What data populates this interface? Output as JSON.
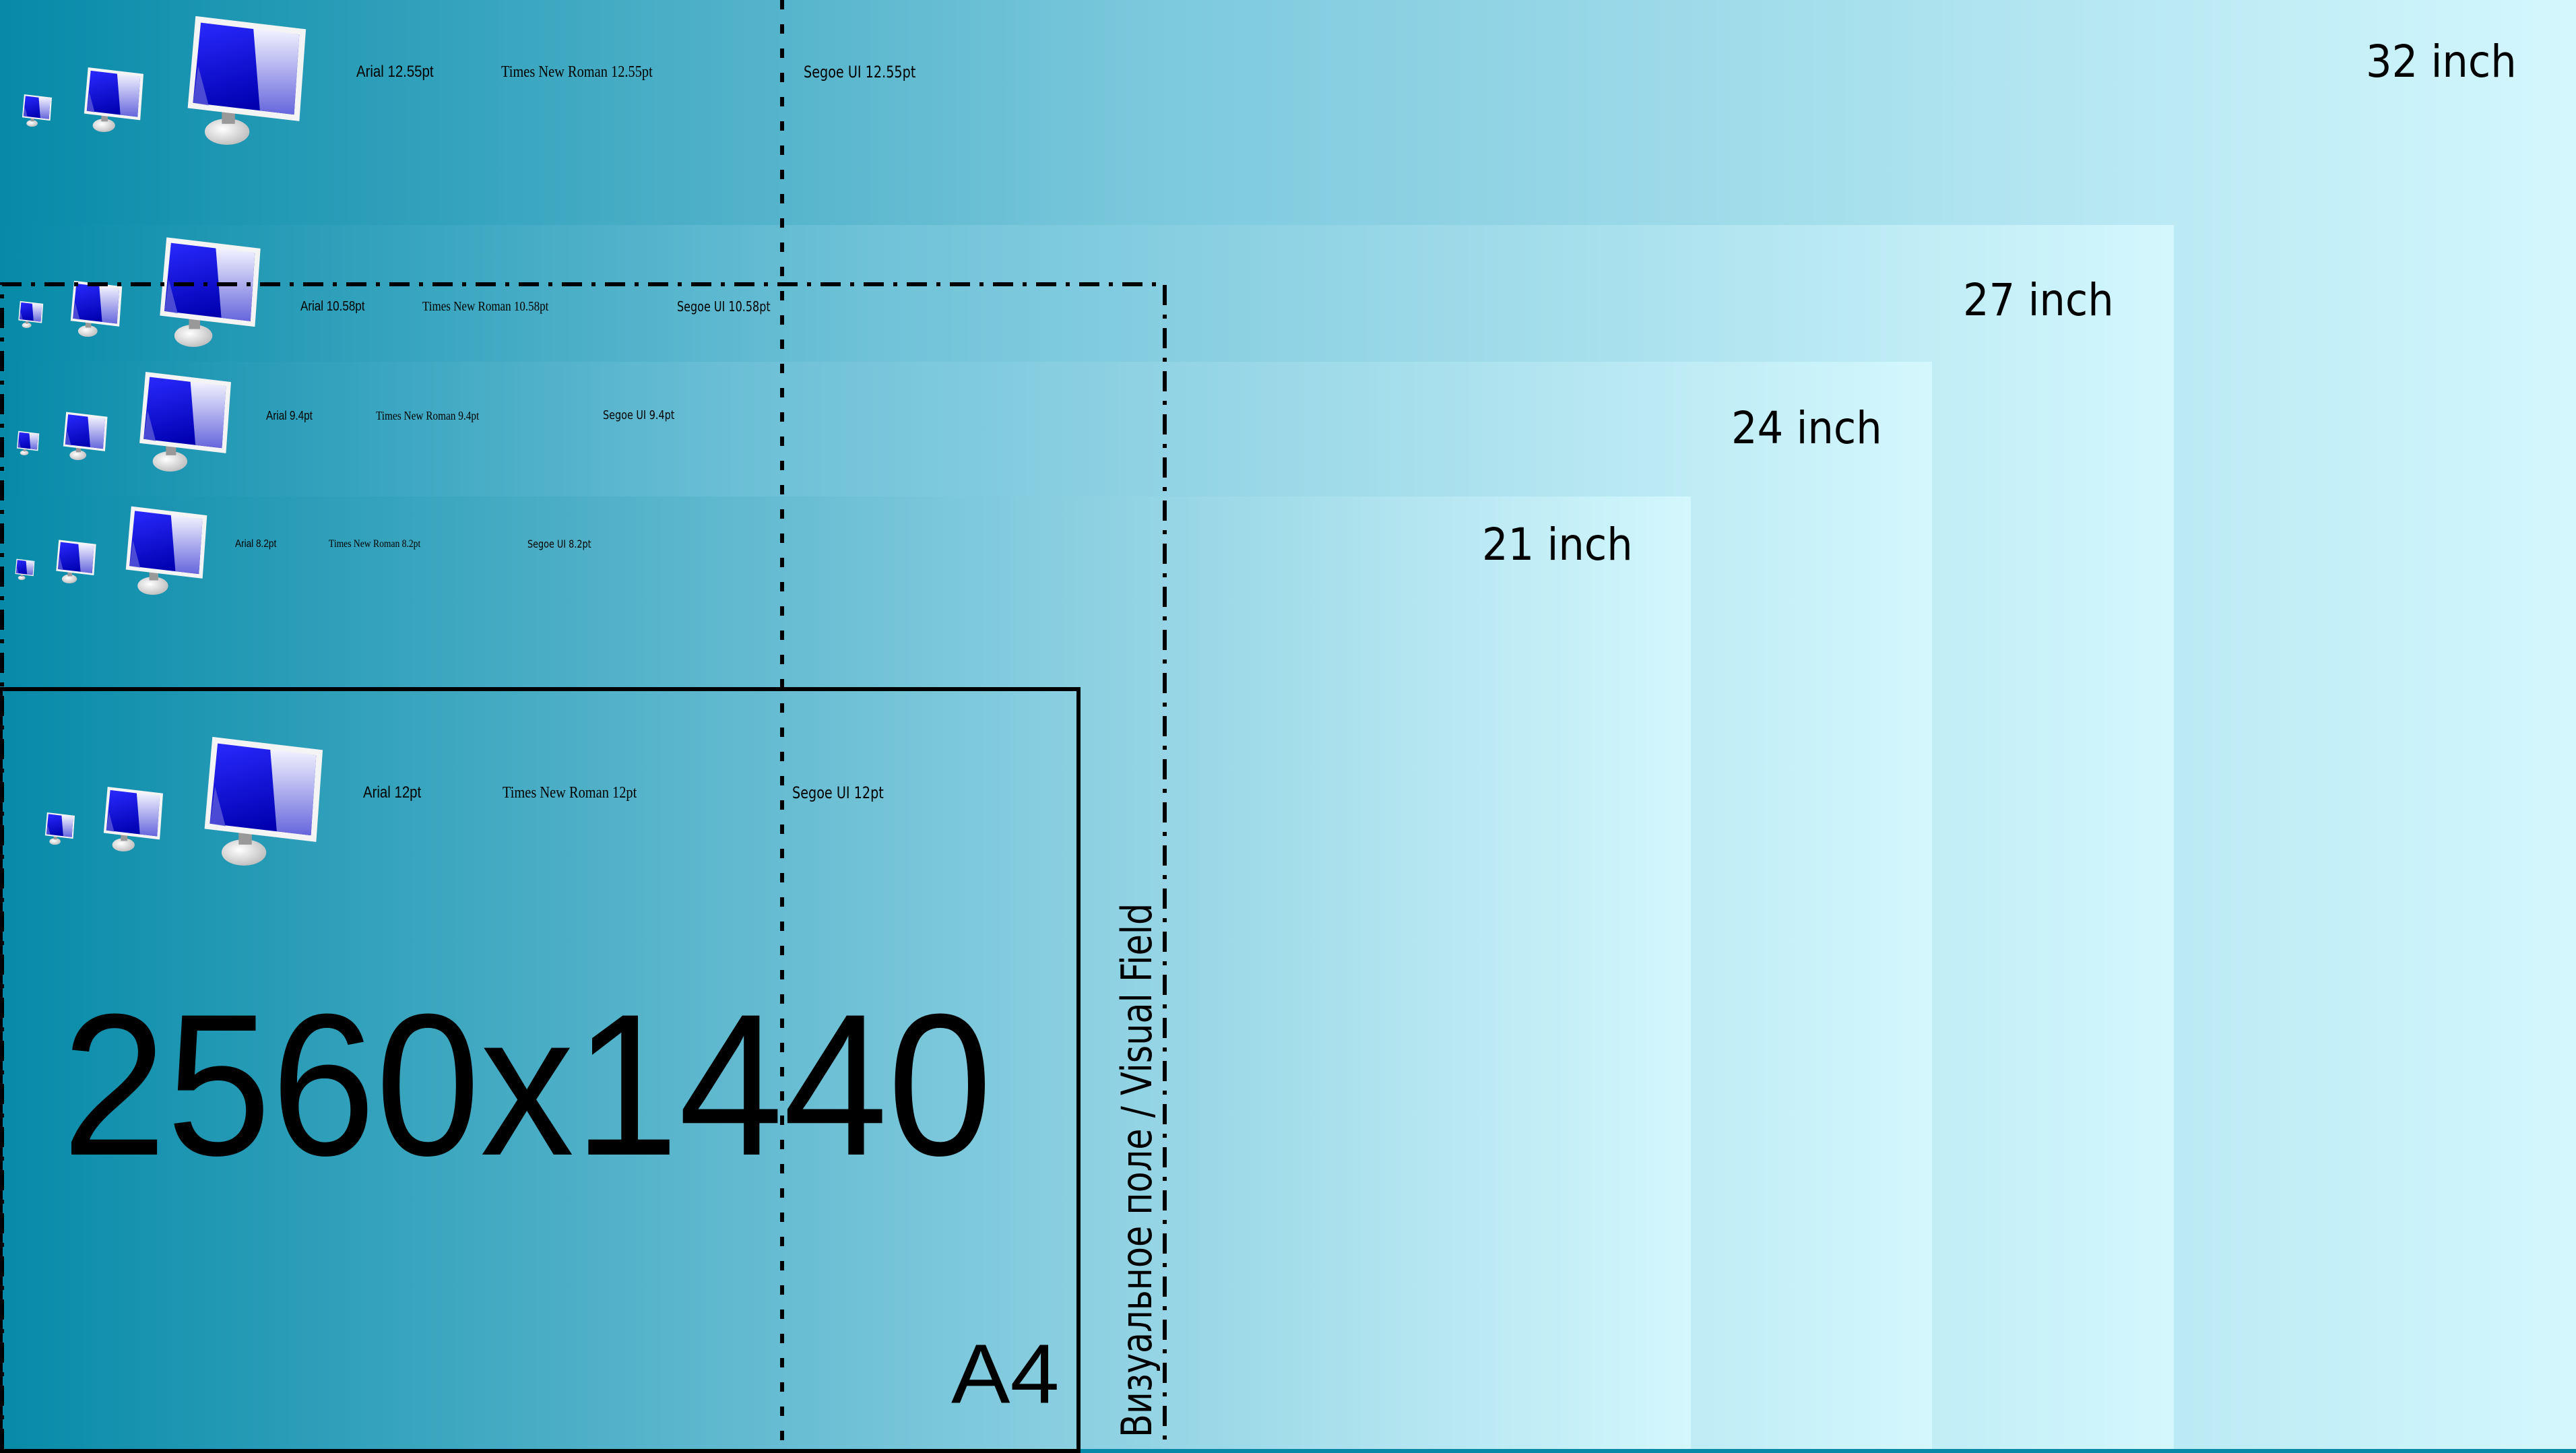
{
  "colors": {
    "gradient_start": "#068aa8",
    "gradient_end": "#d4f7fd",
    "monitor_screen": "#2020ee",
    "line": "#000000"
  },
  "screens": [
    {
      "id": "32",
      "label": "32 inch"
    },
    {
      "id": "27",
      "label": "27 inch"
    },
    {
      "id": "24",
      "label": "24 inch"
    },
    {
      "id": "21",
      "label": "21 inch"
    }
  ],
  "rows": [
    {
      "arial": "Arial 12.55pt",
      "tnr": "Times New Roman 12.55pt",
      "segoe": "Segoe UI 12.55pt"
    },
    {
      "arial": "Arial 10.58pt",
      "tnr": "Times New Roman 10.58pt",
      "segoe": "Segoe UI 10.58pt"
    },
    {
      "arial": "Arial 9.4pt",
      "tnr": "Times New Roman 9.4pt",
      "segoe": "Segoe UI 9.4pt"
    },
    {
      "arial": "Arial 8.2pt",
      "tnr": "Times New Roman 8.2pt",
      "segoe": "Segoe UI 8.2pt"
    },
    {
      "arial": "Arial 12pt",
      "tnr": "Times New Roman 12pt",
      "segoe": "Segoe UI 12pt"
    }
  ],
  "resolution": "2560x1440",
  "a4_label": "A4",
  "visual_field_label": "Визуальное поле / Visual Field",
  "icons": {
    "monitor": "monitor-icon"
  }
}
